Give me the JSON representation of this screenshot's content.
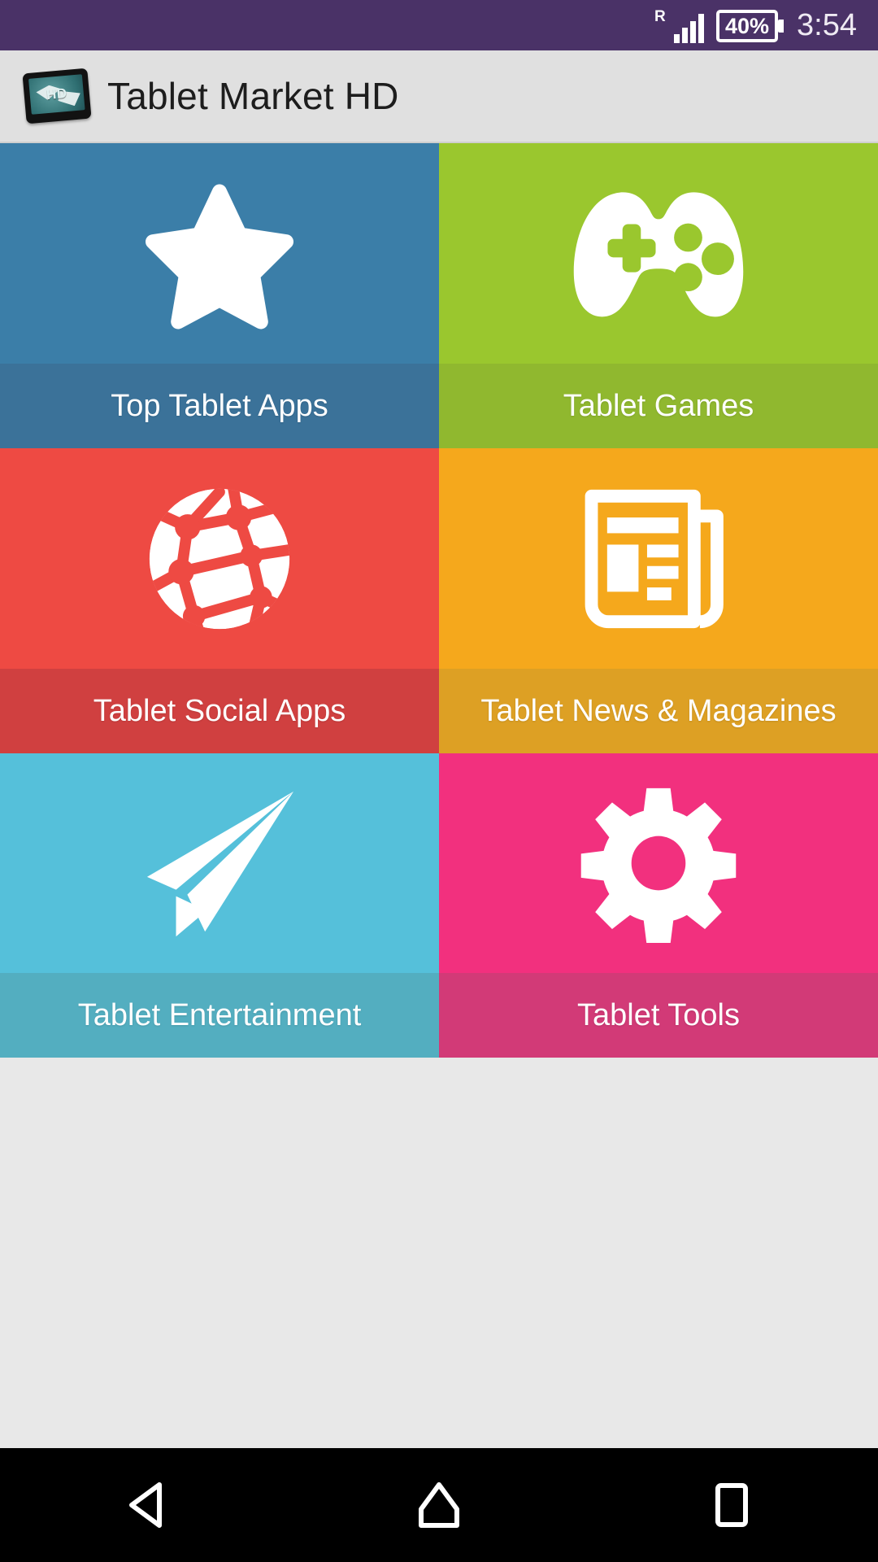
{
  "status_bar": {
    "roaming_indicator": "R",
    "signal_icon": "signal-bars-icon",
    "battery_text": "40%",
    "time": "3:54",
    "background_color": "#4a3267"
  },
  "app_bar": {
    "icon": "tablet-hd-icon",
    "icon_text": "HD",
    "title": "Tablet Market HD",
    "background_color": "#e0e0e0"
  },
  "grid": {
    "tiles": [
      {
        "id": "top-tablet-apps",
        "label": "Top Tablet Apps",
        "icon": "star-icon",
        "color": "#3b7ea8",
        "label_color": "#3b7299"
      },
      {
        "id": "tablet-games",
        "label": "Tablet Games",
        "icon": "gamepad-icon",
        "color": "#9ac72e",
        "label_color": "#90b82f"
      },
      {
        "id": "tablet-social-apps",
        "label": "Tablet Social Apps",
        "icon": "globe-network-icon",
        "color": "#ee4a43",
        "label_color": "#d04040"
      },
      {
        "id": "tablet-news-magazines",
        "label": "Tablet News & Magazines",
        "icon": "newspaper-icon",
        "color": "#f5a81c",
        "label_color": "#dda024"
      },
      {
        "id": "tablet-entertainment",
        "label": "Tablet Entertainment",
        "icon": "paper-plane-icon",
        "color": "#55c0da",
        "label_color": "#53aec0"
      },
      {
        "id": "tablet-tools",
        "label": "Tablet Tools",
        "icon": "gear-icon",
        "color": "#f2307e",
        "label_color": "#d23a77"
      }
    ]
  },
  "nav_bar": {
    "background_color": "#000000",
    "buttons": [
      {
        "id": "back",
        "icon": "back-triangle-icon"
      },
      {
        "id": "home",
        "icon": "home-icon"
      },
      {
        "id": "recents",
        "icon": "recents-square-icon"
      }
    ]
  }
}
